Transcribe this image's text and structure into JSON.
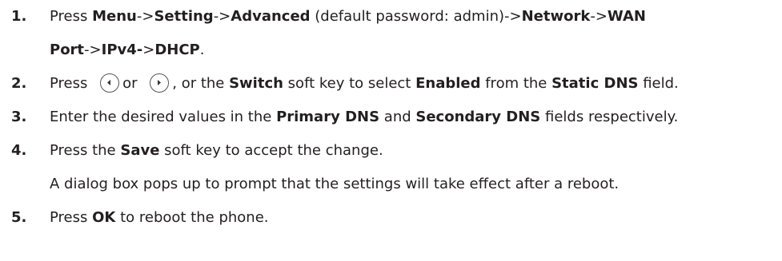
{
  "steps": [
    {
      "num": "1.",
      "line1": {
        "t1": "Press ",
        "menu": "Menu",
        "a1": "->",
        "setting": "Setting",
        "a2": "->",
        "advanced": "Advanced",
        "paren": " (default password: admin)->",
        "network": "Network",
        "a3": "->",
        "wan": "WAN"
      },
      "line2": {
        "port": "Port",
        "a4": "->",
        "ipv4": "IPv4-",
        "a5": ">",
        "dhcp": "DHCP",
        "end": "."
      }
    },
    {
      "num": "2.",
      "t1": "Press ",
      "or": "or ",
      "t2": ", or the ",
      "switch": "Switch",
      "t3": " soft key to select ",
      "enabled": "Enabled",
      "t4": " from the ",
      "static_dns": "Static DNS",
      "t5": " field."
    },
    {
      "num": "3.",
      "t1": "Enter the desired values in the ",
      "primary": "Primary DNS",
      "t2": " and ",
      "secondary": "Secondary DNS",
      "t3": " fields respectively."
    },
    {
      "num": "4.",
      "t1": "Press the ",
      "save": "Save",
      "t2": " soft key to accept the change.",
      "note": "A dialog box pops up to prompt that the settings will take effect after a reboot."
    },
    {
      "num": "5.",
      "t1": "Press ",
      "ok": "OK",
      "t2": " to reboot the phone."
    }
  ],
  "icons": {
    "left": "left-arrow-key-icon",
    "right": "right-arrow-key-icon"
  }
}
